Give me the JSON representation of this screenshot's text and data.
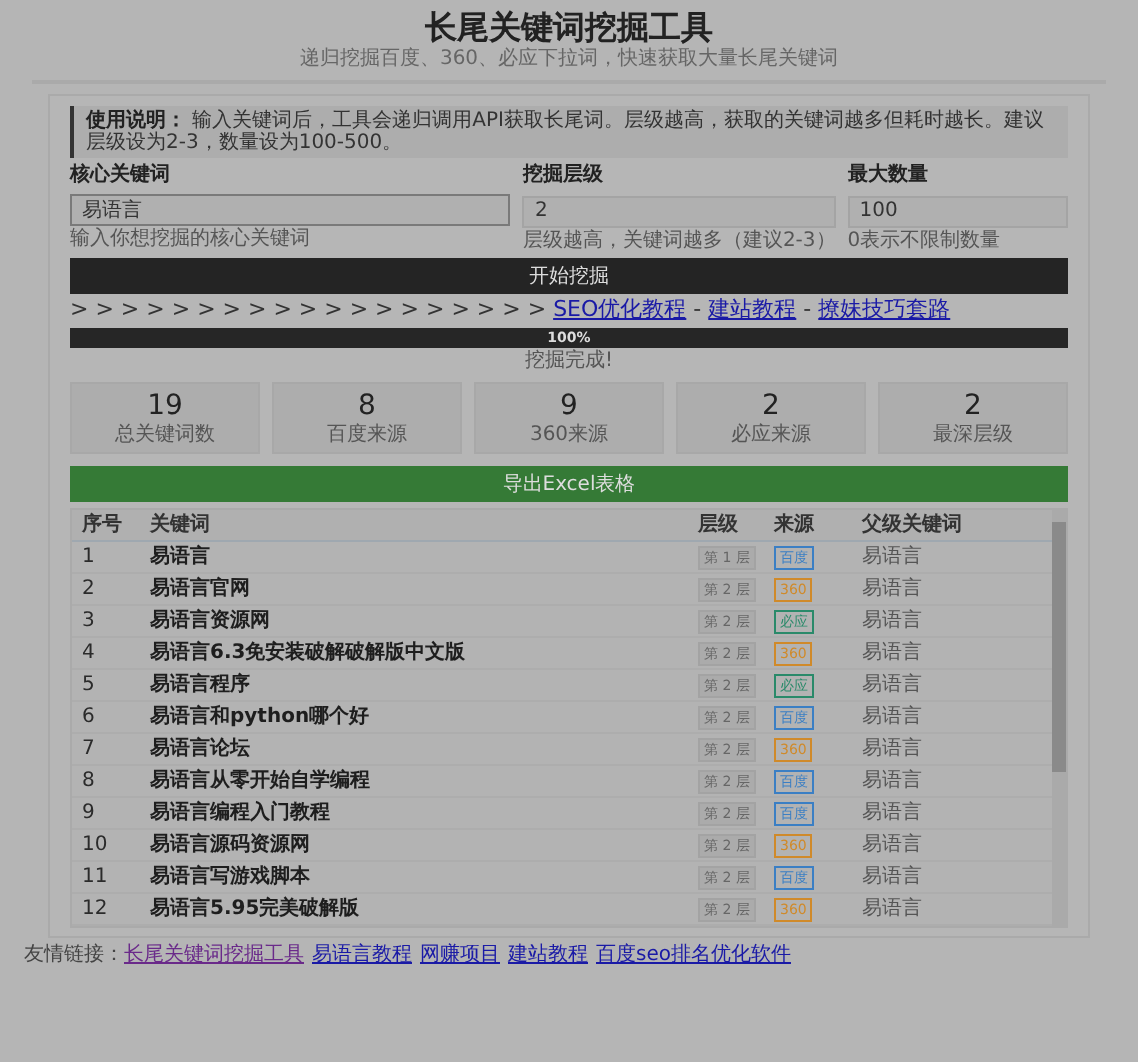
{
  "header": {
    "title": "长尾关键词挖掘工具",
    "subtitle": "递归挖掘百度、360、必应下拉词，快速获取大量长尾关键词"
  },
  "notice": {
    "text": "**使用说明：** 输入关键词后，工具会递归调用API获取长尾词。层级越高，获取的关键词越多但耗时越长。建议层级设为2-3，数量设为100-500。"
  },
  "fields": [
    {
      "label": "核心关键词",
      "value": "易语言",
      "hint": "输入你想挖掘的核心关键词",
      "focused": true
    },
    {
      "label": "挖掘层级",
      "value": "2",
      "hint": "层级越高，关键词越多（建议2-3）",
      "focused": false
    },
    {
      "label": "最大数量",
      "value": "100",
      "hint": "0表示不限制数量",
      "focused": false
    }
  ],
  "start_button": "开始挖掘",
  "promo": {
    "prefix": "> > > > > > > > > > > > > > > > > > >",
    "separator": "-",
    "links": [
      "SEO优化教程",
      "建站教程",
      "撩妹技巧套路"
    ]
  },
  "progress": {
    "level": 1,
    "label": "100%",
    "status": "挖掘完成!"
  },
  "stats": [
    {
      "value": "19",
      "label": "总关键词数"
    },
    {
      "value": "8",
      "label": "百度来源"
    },
    {
      "value": "9",
      "label": "360来源"
    },
    {
      "value": "2",
      "label": "必应来源"
    },
    {
      "value": "2",
      "label": "最深层级"
    }
  ],
  "export_button": "导出Excel表格",
  "table": {
    "columns": [
      "序号",
      "关键词",
      "层级",
      "来源",
      "父级关键词"
    ],
    "rows": [
      {
        "index": "1",
        "keyword": "易语言",
        "level": "第 1 层",
        "source": "百度",
        "color": "#3b7fc4",
        "parent": "易语言"
      },
      {
        "index": "2",
        "keyword": "易语言官网",
        "level": "第 2 层",
        "source": "360",
        "color": "#d08a2a",
        "parent": "易语言"
      },
      {
        "index": "3",
        "keyword": "易语言资源网",
        "level": "第 2 层",
        "source": "必应",
        "color": "#2a8a6a",
        "parent": "易语言"
      },
      {
        "index": "4",
        "keyword": "易语言6.3免安装破解破解版中文版",
        "level": "第 2 层",
        "source": "360",
        "color": "#d08a2a",
        "parent": "易语言"
      },
      {
        "index": "5",
        "keyword": "易语言程序",
        "level": "第 2 层",
        "source": "必应",
        "color": "#2a8a6a",
        "parent": "易语言"
      },
      {
        "index": "6",
        "keyword": "易语言和python哪个好",
        "level": "第 2 层",
        "source": "百度",
        "color": "#3b7fc4",
        "parent": "易语言"
      },
      {
        "index": "7",
        "keyword": "易语言论坛",
        "level": "第 2 层",
        "source": "360",
        "color": "#d08a2a",
        "parent": "易语言"
      },
      {
        "index": "8",
        "keyword": "易语言从零开始自学编程",
        "level": "第 2 层",
        "source": "百度",
        "color": "#3b7fc4",
        "parent": "易语言"
      },
      {
        "index": "9",
        "keyword": "易语言编程入门教程",
        "level": "第 2 层",
        "source": "百度",
        "color": "#3b7fc4",
        "parent": "易语言"
      },
      {
        "index": "10",
        "keyword": "易语言源码资源网",
        "level": "第 2 层",
        "source": "360",
        "color": "#d08a2a",
        "parent": "易语言"
      },
      {
        "index": "11",
        "keyword": "易语言写游戏脚本",
        "level": "第 2 层",
        "source": "百度",
        "color": "#3b7fc4",
        "parent": "易语言"
      },
      {
        "index": "12",
        "keyword": "易语言5.95完美破解版",
        "level": "第 2 层",
        "source": "360",
        "color": "#d08a2a",
        "parent": "易语言"
      }
    ]
  },
  "footer": {
    "label": "友情链接：",
    "links": [
      {
        "text": "长尾关键词挖掘工具",
        "visited": true
      },
      {
        "text": "易语言教程",
        "visited": false
      },
      {
        "text": "网赚项目",
        "visited": false
      },
      {
        "text": "建站教程",
        "visited": false
      },
      {
        "text": "百度seo排名优化软件",
        "visited": false
      }
    ]
  }
}
